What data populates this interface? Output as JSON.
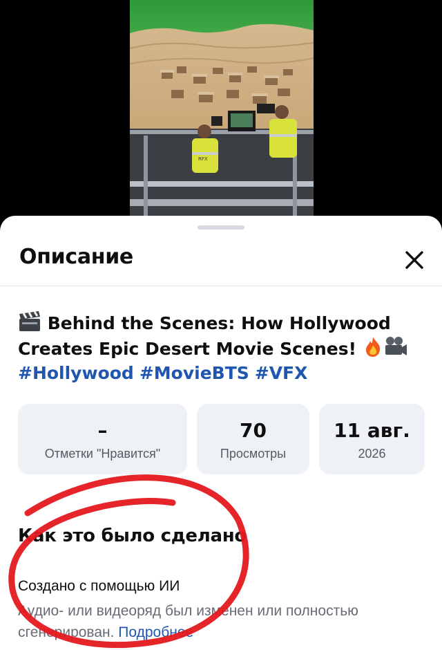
{
  "sheet": {
    "title": "Описание",
    "close_icon": "close-icon"
  },
  "video": {
    "title_icon_start": "clapper-icon",
    "title_text": "Behind the Scenes: How Hollywood Creates Epic Desert Movie Scenes!",
    "title_icons_end": [
      "fire-icon",
      "camera-icon"
    ],
    "hashtags": [
      "#Hollywood",
      "#MovieBTS",
      "#VFX"
    ],
    "vest_label": "RFX"
  },
  "stats": [
    {
      "value": "–",
      "label": "Отметки \"Нравится\""
    },
    {
      "value": "70",
      "label": "Просмотры"
    },
    {
      "value": "11 авг.",
      "label": "2026"
    }
  ],
  "how_made": {
    "section_title": "Как это было сделано",
    "heading": "Создано с помощью ИИ",
    "description": "Аудио- или видеоряд был изменен или полностью сгенерирован.",
    "link_label": "Подробнее"
  },
  "colors": {
    "link": "#1e56b0",
    "annotation": "#e4191f",
    "stat_card": "#eef1f6"
  }
}
